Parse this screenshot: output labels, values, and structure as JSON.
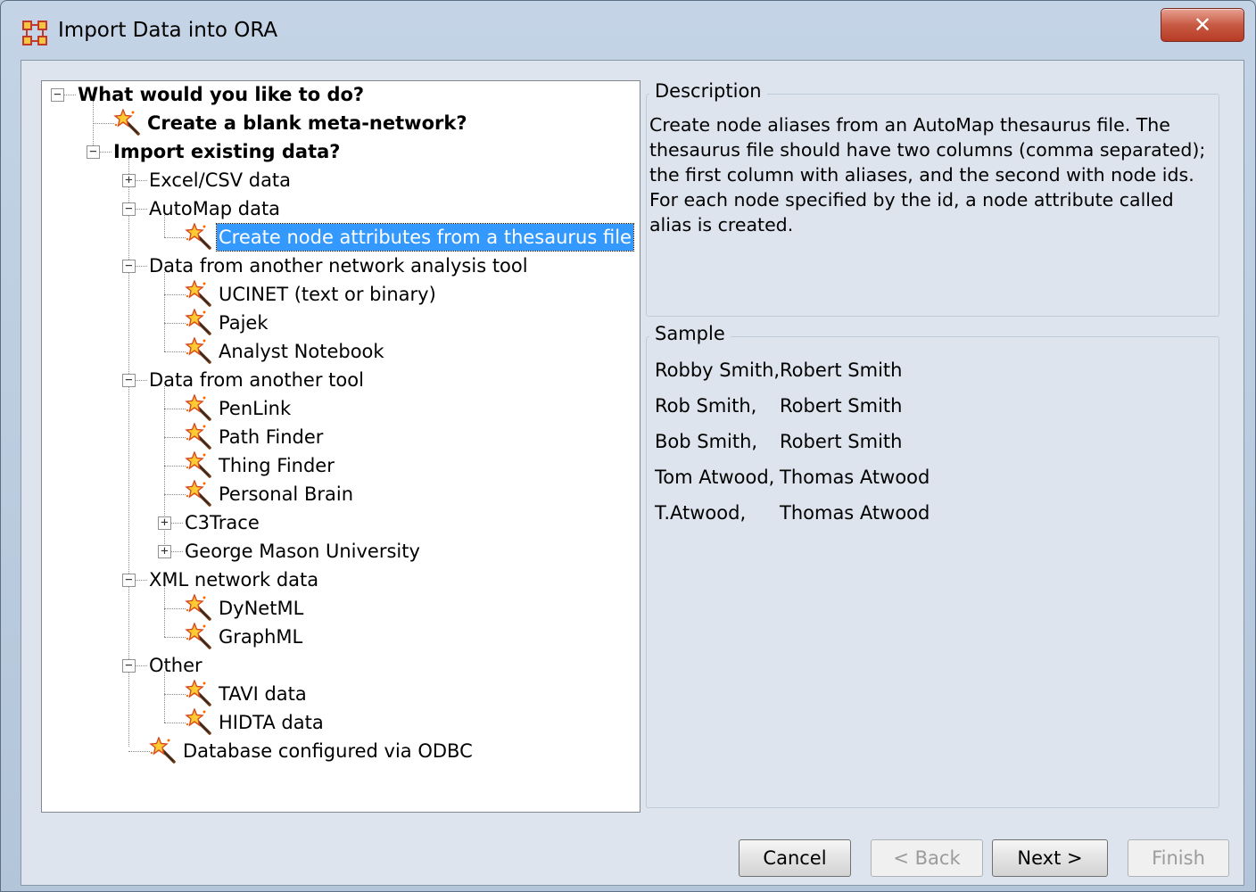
{
  "window": {
    "title": "Import Data into ORA",
    "close_label": "✕"
  },
  "tree": {
    "root": "What would you like to do?",
    "blank": "Create a blank meta-network?",
    "import_existing": "Import existing data?",
    "excel": "Excel/CSV data",
    "automap": "AutoMap data",
    "automap_child": "Create node attributes from a thesaurus file",
    "network_tool": "Data from another network analysis tool",
    "ucinet": "UCINET (text or binary)",
    "pajek": "Pajek",
    "analyst": "Analyst Notebook",
    "another_tool": "Data from another tool",
    "penlink": "PenLink",
    "pathfinder": "Path Finder",
    "thingfinder": "Thing Finder",
    "personalbrain": "Personal Brain",
    "c3trace": "C3Trace",
    "gmu": "George Mason University",
    "xml": "XML network data",
    "dynetml": "DyNetML",
    "graphml": "GraphML",
    "other": "Other",
    "tavi": "TAVI data",
    "hidta": "HIDTA data",
    "odbc": "Database configured via ODBC"
  },
  "description": {
    "title": "Description",
    "text": "Create node aliases from an AutoMap thesaurus file. The thesaurus file should have two columns (comma separated); the first column with aliases, and the second with node ids. For each node specified by the id, a node attribute called alias is created."
  },
  "sample": {
    "title": "Sample",
    "rows": [
      [
        "Robby Smith,",
        "Robert Smith"
      ],
      [
        "Rob Smith,",
        "Robert Smith"
      ],
      [
        "Bob Smith,",
        "Robert Smith"
      ],
      [
        "Tom Atwood,",
        "Thomas Atwood"
      ],
      [
        "T.Atwood,",
        "Thomas Atwood"
      ]
    ]
  },
  "buttons": {
    "cancel": "Cancel",
    "back": "< Back",
    "next": "Next >",
    "finish": "Finish"
  },
  "icons": {
    "app": "network-grid-icon",
    "node": "magic-wand-icon"
  },
  "colors": {
    "selection": "#3399ff",
    "close": "#c75a44"
  }
}
